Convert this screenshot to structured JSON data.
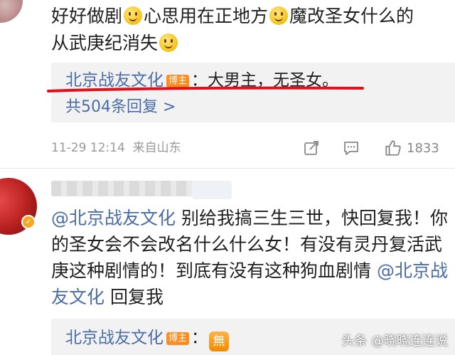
{
  "comment1": {
    "text_parts": [
      "好好做剧",
      "心思用在正地方",
      "魔改圣女什么的",
      "从武庚纪消失"
    ],
    "emoji": "smile-emoji",
    "reply": {
      "author": "北京战友文化",
      "badge": "博主",
      "text": "：大男主，无圣女。"
    },
    "more_replies": "共504条回复 >",
    "timestamp": "11-29 12:14",
    "source": "来自山东",
    "like_count": "1833"
  },
  "comment2": {
    "mention1": "@北京战友文化",
    "line_part1": " 别给我搞三生三世，快回复我！你的圣女会不会改名什么什么女！有没有灵丹复活武庚这种剧情的！到底有没有这种狗血剧情 ",
    "mention2": "@北京战友文化",
    "line_part2": " 回复我",
    "reply": {
      "author": "北京战友文化",
      "badge": "博主",
      "icon_text": "無"
    }
  },
  "watermark": "头条 @晓晓连连说",
  "colors": {
    "link": "#4a6da7",
    "badge": "#ff8a1e",
    "highlight_underline": "#e0101c",
    "reply_background": "#f2f2f2"
  }
}
